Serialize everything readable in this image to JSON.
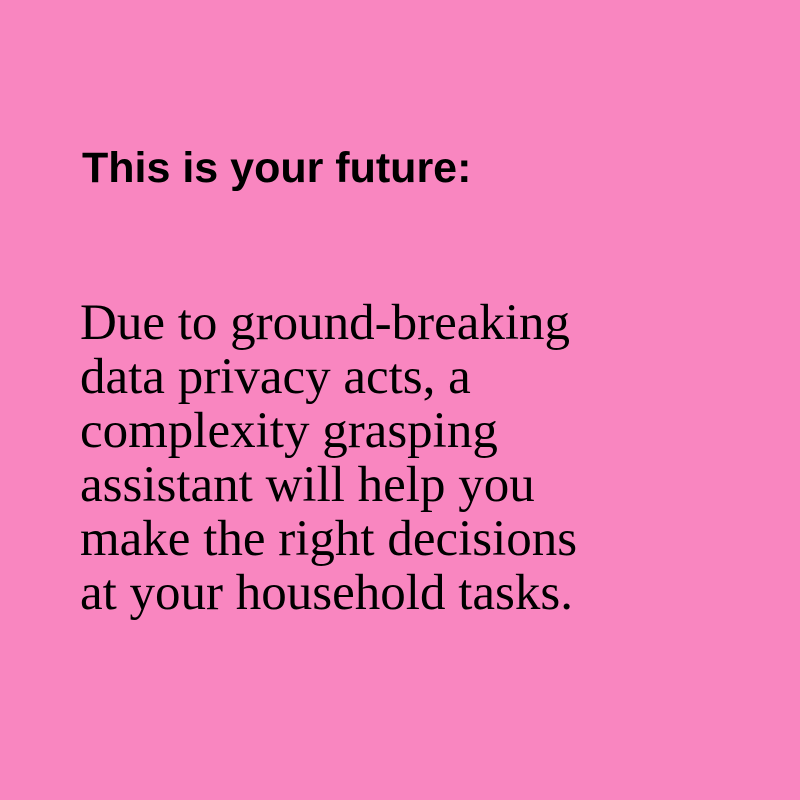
{
  "theme": {
    "background_color": "#f986c0",
    "text_color": "#000000"
  },
  "headline": "This is your future:",
  "body_lines": [
    "Due to ground-breaking",
    "data privacy acts, a",
    "complexity grasping",
    "assistant will help you",
    "make the right decisions",
    "at your household tasks."
  ]
}
